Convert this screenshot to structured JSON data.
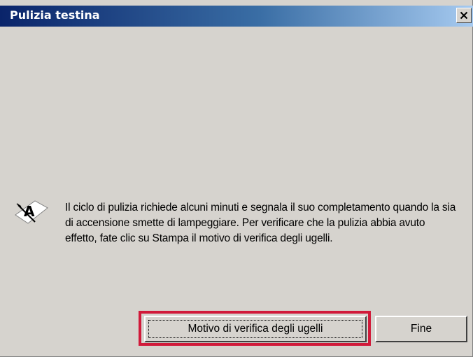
{
  "window": {
    "title": "Pulizia testina",
    "close_label": "X"
  },
  "message": {
    "text": "Il ciclo di pulizia richiede alcuni minuti e segnala il suo completamento quando la sia di accensione smette di lampeggiare. Per verificare che la pulizia abbia avuto effetto, fate clic su Stampa il motivo di verifica degli ugelli.",
    "icon": "print-head-cleaning-icon"
  },
  "buttons": {
    "verify_label": "Motivo di verifica degli ugelli",
    "finish_label": "Fine"
  },
  "colors": {
    "title_gradient_start": "#0a246a",
    "title_gradient_end": "#a6caf0",
    "dialog_background": "#d6d3ce",
    "highlight": "#d11a3a"
  }
}
